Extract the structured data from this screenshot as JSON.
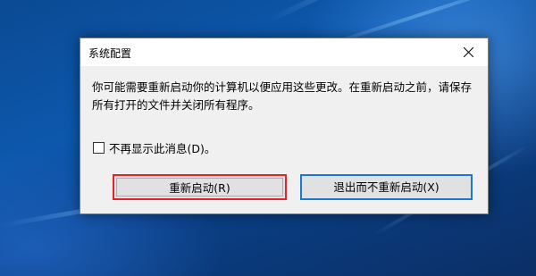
{
  "dialog": {
    "title": "系统配置",
    "message": "你可能需要重新启动你的计算机以便应用这些更改。在重新启动之前，请保存所有打开的文件并关闭所有程序。",
    "checkbox_label": "不再显示此消息(D)。",
    "checkbox_checked": false,
    "buttons": {
      "restart": "重新启动(R)",
      "exit_without_restart": "退出而不重新启动(X)"
    }
  },
  "colors": {
    "highlight_border": "#e0242d",
    "default_button_border": "#1a78d2"
  },
  "icons": {
    "close": "close-icon"
  }
}
